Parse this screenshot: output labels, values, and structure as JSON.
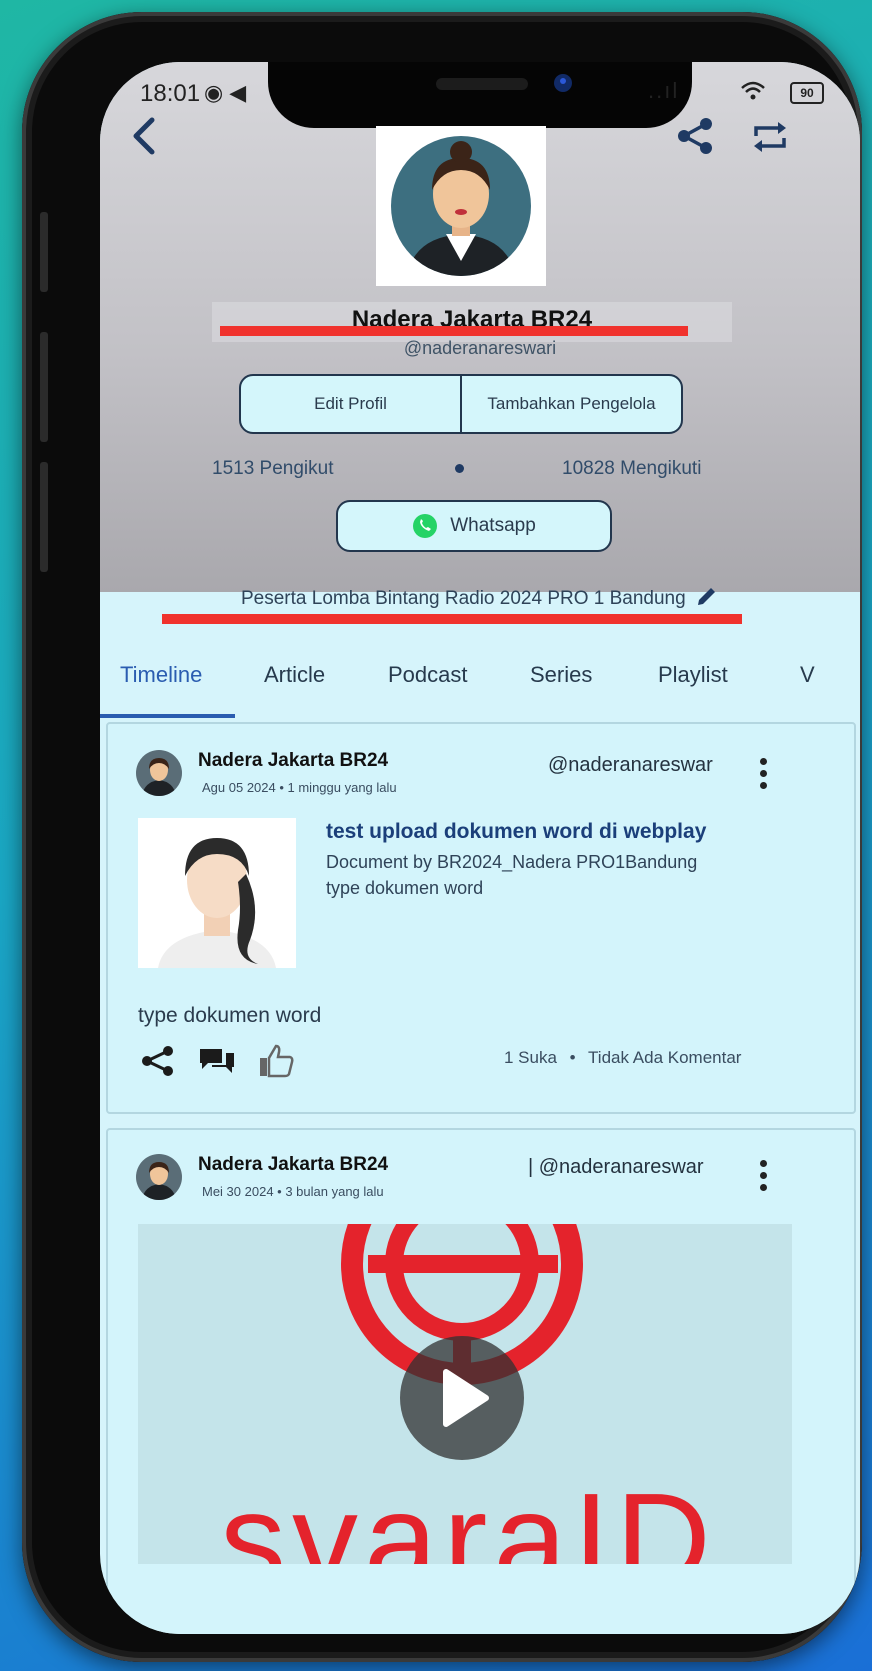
{
  "status_bar": {
    "time": "18:01",
    "signal": "..ıl",
    "battery": "90"
  },
  "profile": {
    "name": "Nadera Jakarta BR24",
    "handle": "@naderanareswari",
    "edit_label": "Edit Profil",
    "add_manager_label": "Tambahkan Pengelola",
    "followers": "1513 Pengikut",
    "following": "10828 Mengikuti",
    "whatsapp_label": "Whatsapp",
    "bio": "Peserta Lomba Bintang Radio 2024 PRO 1 Bandung"
  },
  "tabs": [
    "Timeline",
    "Article",
    "Podcast",
    "Series",
    "Playlist",
    "V"
  ],
  "posts": [
    {
      "author": "Nadera Jakarta BR24",
      "handle": "@naderanareswar",
      "meta": "Agu 05 2024 • 1 minggu yang lalu",
      "doc_title": "test upload dokumen word di webplay",
      "doc_by": "Document by BR2024_Nadera PRO1Bandung",
      "doc_type": "type dokumen word",
      "text": "type dokumen word",
      "likes": "1 Suka",
      "separator": "•",
      "comments": "Tidak Ada Komentar"
    },
    {
      "author": "Nadera Jakarta BR24",
      "handle": "| @naderanareswar",
      "meta": "Mei 30 2024 • 3 bulan yang lalu",
      "media_text": "svaraID"
    }
  ],
  "colors": {
    "accent_tab": "#2a5cb0",
    "highlight_line": "#f0322d",
    "whatsapp": "#25d366",
    "brand_red": "#e4232c"
  },
  "icons": [
    "back-arrow-icon",
    "share-icon",
    "repeat-icon",
    "whatsapp-icon",
    "pencil-icon",
    "comments-icon",
    "thumbs-up-icon",
    "kebab-menu-icon",
    "play-icon"
  ]
}
